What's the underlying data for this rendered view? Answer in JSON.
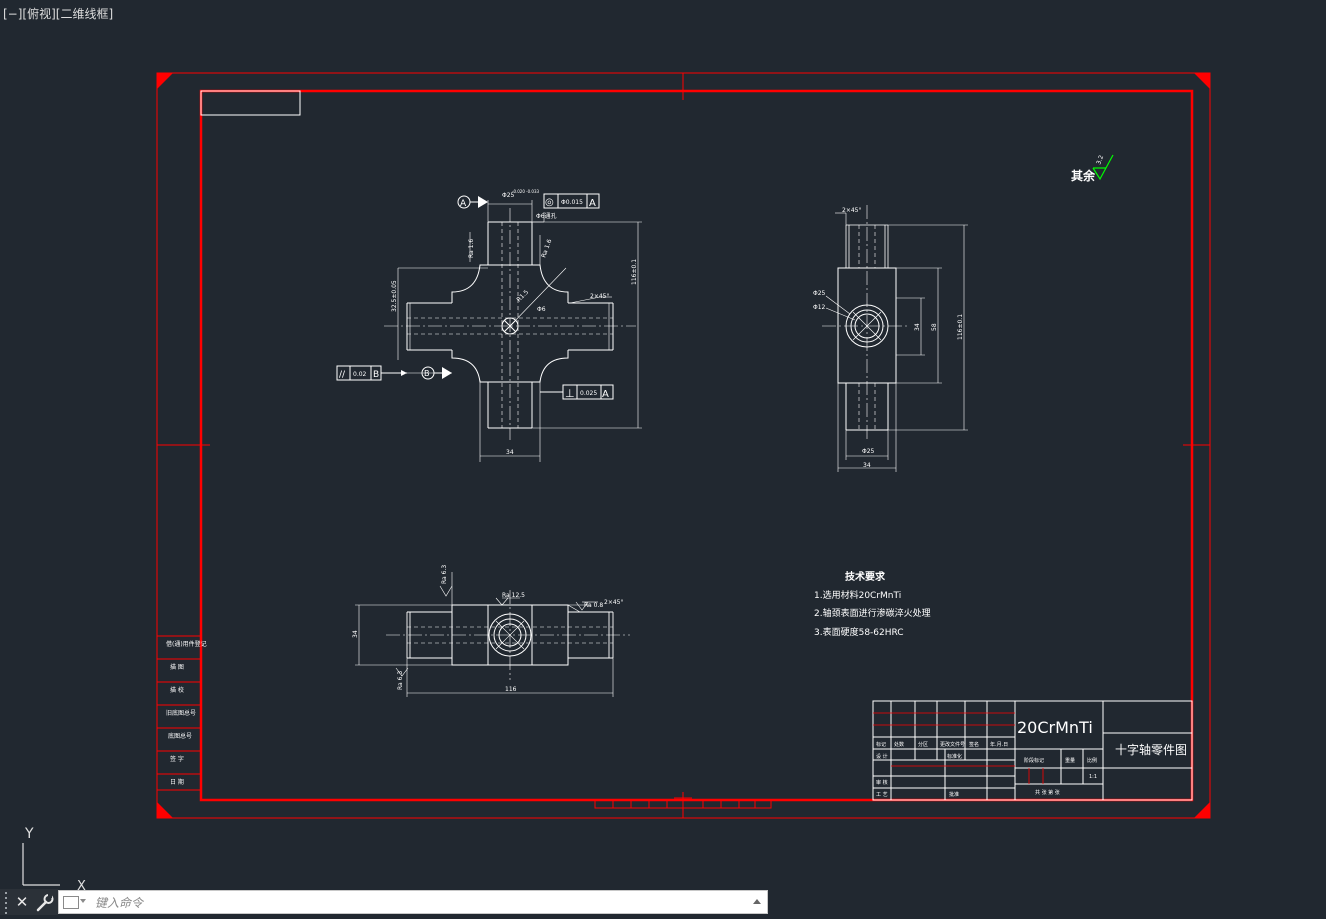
{
  "viewport": {
    "label": "[−][俯视][二维线框]"
  },
  "ucs": {
    "y_label": "Y",
    "x_label": "X"
  },
  "colors": {
    "background": "#212830",
    "frame": "#ff0000",
    "geometry": "#ffffff",
    "roughness_mark": "#00ff00"
  },
  "drawing": {
    "roughness_note": {
      "text": "其余",
      "value": "3.2"
    },
    "datum_a": "A",
    "datum_b": "B",
    "tolerances": {
      "coaxiality": {
        "symbol": "◎",
        "value": "Φ0.015",
        "datum": "A"
      },
      "parallelism": {
        "symbol": "//",
        "value": "0.02",
        "datum": "B"
      },
      "perpendicularity": {
        "symbol": "⊥",
        "value": "0.025",
        "datum": "A"
      }
    },
    "dimensions": {
      "front_shaft_dia": "Φ25",
      "front_shaft_dia_tol": "-0.020 -0.033",
      "front_hole_note": "Φ6通孔",
      "front_ra_left": "Ra 1.6",
      "front_ra_right": "Ra 1.6",
      "front_height_total": "116±0.1",
      "front_width_left": "32.5±0.05",
      "front_r_dim": "R1.5",
      "front_hole_center": "Φ6",
      "front_chamfer": "2×45°",
      "front_bottom_width": "34",
      "side_chamfer": "2×45°",
      "side_dia_outer": "Φ25",
      "side_dia_inner": "Φ12",
      "side_dim_a": "34",
      "side_dim_b": "58",
      "side_total_height": "116±0.1",
      "side_bottom_dia": "Φ25",
      "side_bottom_width": "34",
      "top_ra_left": "Ra 6.3",
      "top_ra_mid": "Ra 12.5",
      "top_ra_right": "Ra 0.8",
      "top_chamfer": "2×45°",
      "top_height": "34",
      "top_ra_bottom": "Ra 6.3",
      "top_length": "116"
    },
    "tech_requirements": {
      "title": "技术要求",
      "items": [
        "1.选用材料20CrMnTi",
        "2.轴颈表面进行渗碳淬火处理",
        "3.表面硬度58-62HRC"
      ]
    },
    "left_strip_labels": [
      "借(通)用件登记",
      "描 图",
      "描 校",
      "旧底图总号",
      "底图总号",
      "签 字",
      "日 期"
    ],
    "title_block": {
      "material": "20CrMnTi",
      "part_name": "十字轴零件图",
      "row_labels": [
        "标记",
        "处数",
        "分区",
        "更改文件号",
        "签名",
        "年.月.日"
      ],
      "designer": "设 计",
      "standardization": "标准化",
      "review": "审 核",
      "process": "工 艺",
      "approve": "批准",
      "stage_mark": "阶段标记",
      "weight": "重量",
      "scale": "比例",
      "scale_value": "1:1",
      "sheets": "共 张 第 张"
    }
  },
  "command_line": {
    "close_label": "✕",
    "placeholder": "键入命令",
    "value": ""
  }
}
